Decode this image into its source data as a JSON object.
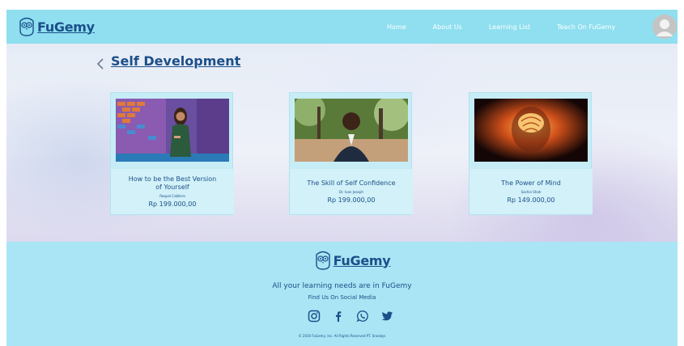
{
  "brand": {
    "name": "FuGemy"
  },
  "nav": {
    "items": [
      {
        "label": "Home"
      },
      {
        "label": "About Us"
      },
      {
        "label": "Learning List"
      },
      {
        "label": "Teach On FuGemy"
      }
    ]
  },
  "page": {
    "title": "Self Development"
  },
  "courses": [
    {
      "title": "How to be the Best Version of Yourself",
      "author": "Raquel Cabllero",
      "price": "Rp 199.000,00"
    },
    {
      "title": "The Skill of Self Confidence",
      "author": "Dr. Ivan Joseph",
      "price": "Rp 199.000,00"
    },
    {
      "title": "The Power of Mind",
      "author": "Sachin Shah",
      "price": "Rp 149.000,00"
    }
  ],
  "footer": {
    "tagline": "All your learning needs are in FuGemy",
    "social_heading": "Find Us On Social Media",
    "social_icons": [
      "instagram-icon",
      "facebook-icon",
      "whatsapp-icon",
      "twitter-icon"
    ],
    "copyright": "© 2010 FuGemy, Inc. All Rights Reserved PT. Sneakys"
  },
  "colors": {
    "header": "#8fdff0",
    "footer": "#a9e5f4",
    "text": "#1b4f8a",
    "card": "#c6ecf6"
  }
}
